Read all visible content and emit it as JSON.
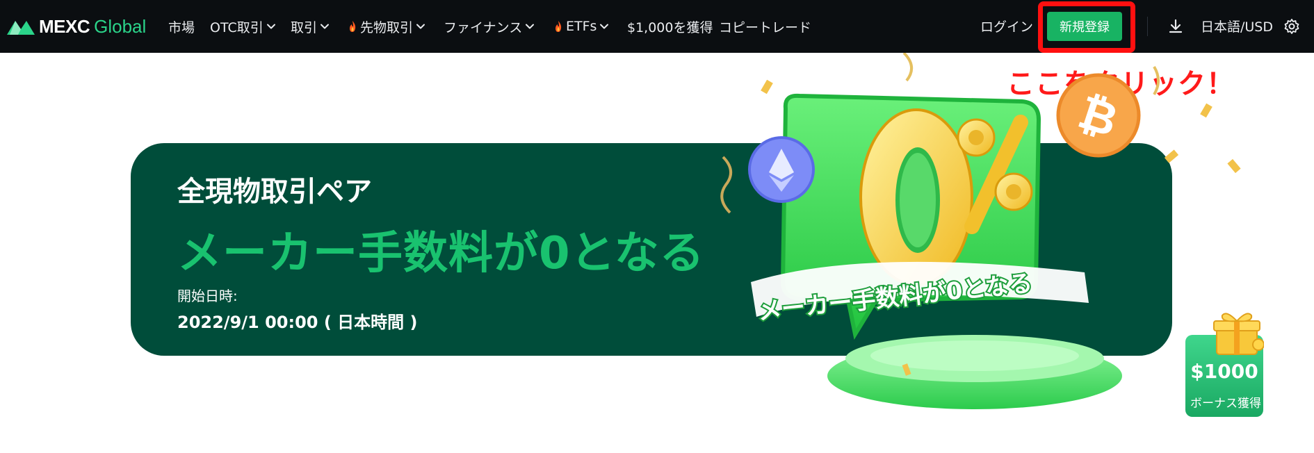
{
  "header": {
    "logo_word": "MEXC",
    "logo_sub": "Global",
    "nav": [
      {
        "label": "市場",
        "dropdown": false,
        "flame": false
      },
      {
        "label": "OTC取引",
        "dropdown": true,
        "flame": false
      },
      {
        "label": "取引",
        "dropdown": true,
        "flame": false
      },
      {
        "label": "先物取引",
        "dropdown": true,
        "flame": true
      },
      {
        "label": "ファイナンス",
        "dropdown": true,
        "flame": false
      },
      {
        "label": "ETFs",
        "dropdown": true,
        "flame": true
      },
      {
        "label": "$1,000を獲得",
        "dropdown": false,
        "flame": false
      },
      {
        "label": "コピートレード",
        "dropdown": false,
        "flame": false
      }
    ],
    "login_label": "ログイン",
    "signup_label": "新規登録",
    "language_label": "日本語/USD"
  },
  "annotation": {
    "text": "ここをクリック！",
    "color": "#ff1a1a"
  },
  "banner": {
    "subtitle": "全現物取引ペア",
    "title": "メーカー手数料が0となる",
    "start_label": "開始日時:",
    "start_date": "2022/9/1 00:00 ( 日本時間 )",
    "art_big_text": "0%",
    "art_ribbon_text": "メーカー手数料が0となる"
  },
  "bonus": {
    "amount": "$1000",
    "label": "ボーナス獲得"
  },
  "colors": {
    "topbar": "#0b0e11",
    "brand_green": "#18b363",
    "banner_bg": "#004d3a",
    "accent_green": "#19c26f"
  }
}
